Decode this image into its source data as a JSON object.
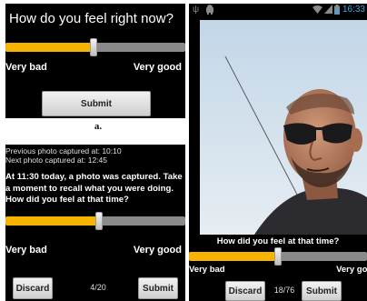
{
  "panel_a": {
    "question": "How do you feel right now?",
    "slider_value_fraction": 0.49,
    "label_low": "Very bad",
    "label_high": "Very good",
    "submit_label": "Submit"
  },
  "caption": "a.",
  "panel_b": {
    "previous_photo": "Previous photo captured at: 10:10",
    "next_photo": "Next photo captured at: 12:45",
    "message": "At 11:30 today, a photo was captured. Take a moment to recall what you were doing. How did you feel at that time?",
    "slider_value_fraction": 0.52,
    "label_low": "Very bad",
    "label_high": "Very good",
    "discard_label": "Discard",
    "counter": "4/20",
    "submit_label": "Submit"
  },
  "panel_c": {
    "status_time": "16:33",
    "status_icons": [
      "usb-icon",
      "android-icon",
      "wifi-icon",
      "signal-icon",
      "battery-icon"
    ],
    "question": "How did you feel at that time?",
    "slider_value_fraction": 0.5,
    "label_low": "Very bad",
    "label_high": "Very good",
    "discard_label": "Discard",
    "counter": "18/76",
    "submit_label": "Submit"
  },
  "colors": {
    "slider_fill": "#f6b400",
    "slider_track": "#8a8a8a",
    "status_time": "#3aa8e8"
  }
}
